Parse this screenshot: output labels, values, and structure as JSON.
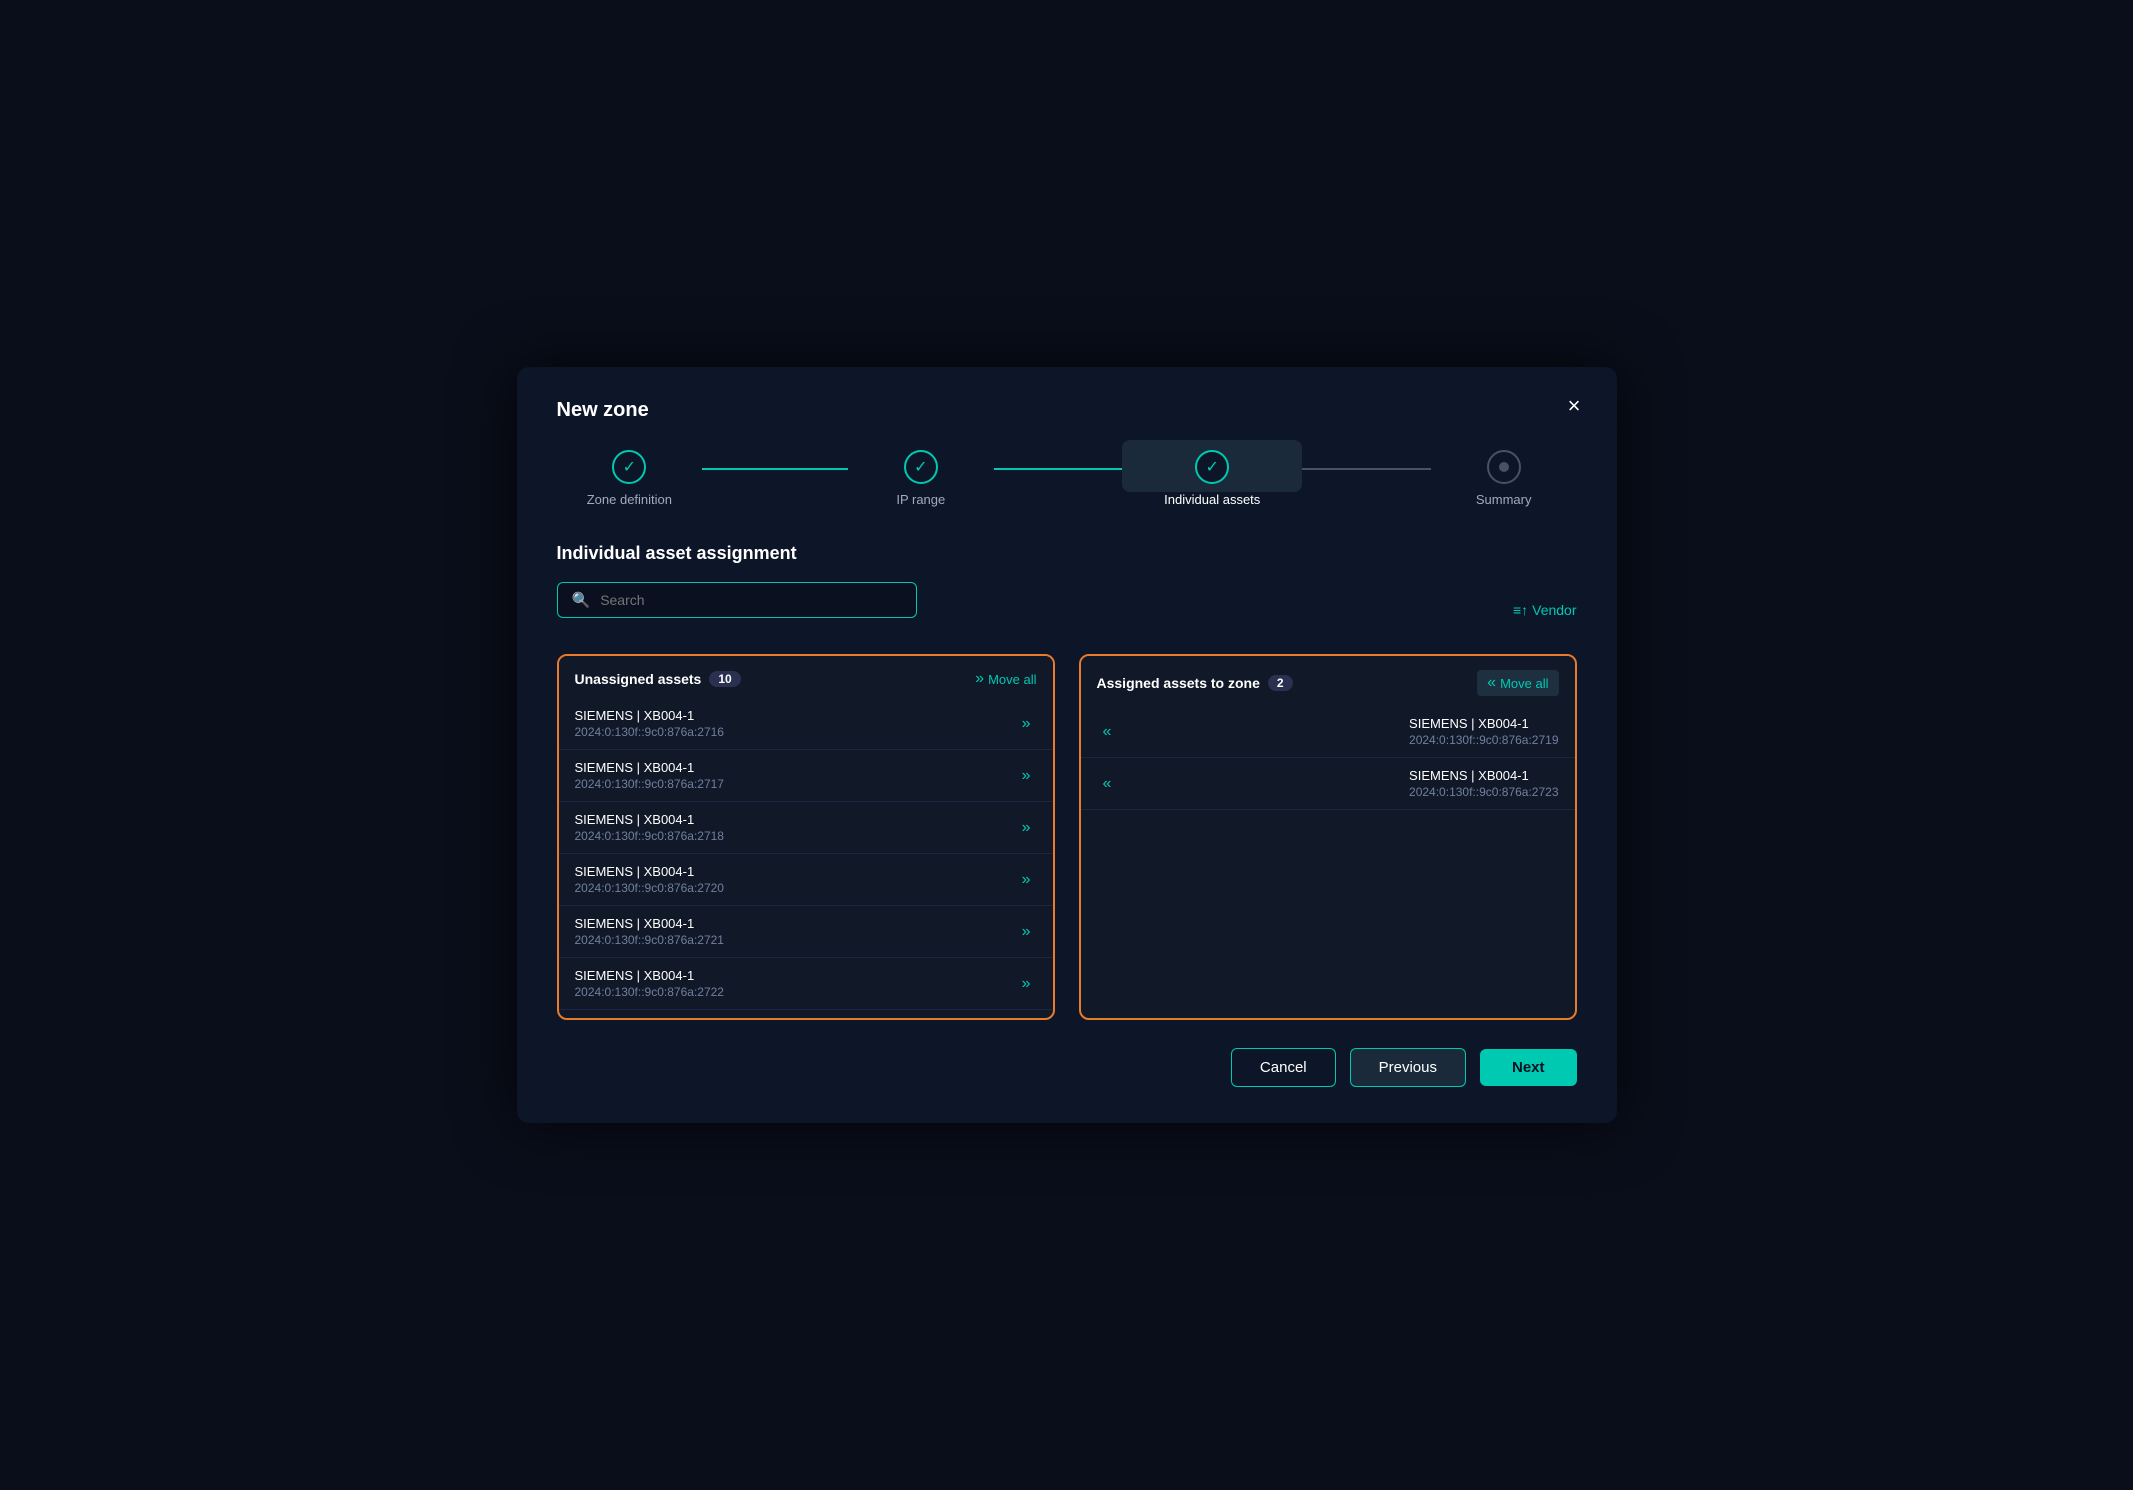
{
  "dialog": {
    "title": "New zone",
    "close_label": "×"
  },
  "stepper": {
    "steps": [
      {
        "label": "Zone definition",
        "state": "completed"
      },
      {
        "label": "IP range",
        "state": "completed"
      },
      {
        "label": "Individual assets",
        "state": "active"
      },
      {
        "label": "Summary",
        "state": "inactive"
      }
    ]
  },
  "section": {
    "title": "Individual asset assignment"
  },
  "search": {
    "placeholder": "Search"
  },
  "vendor_filter": {
    "label": "Vendor"
  },
  "unassigned_panel": {
    "title": "Unassigned assets",
    "count": "10",
    "move_all_label": "Move all"
  },
  "assigned_panel": {
    "title": "Assigned assets to zone",
    "count": "2",
    "move_all_label": "Move all"
  },
  "unassigned_assets": [
    {
      "name": "SIEMENS | XB004-1",
      "ip": "2024:0:130f::9c0:876a:2716"
    },
    {
      "name": "SIEMENS | XB004-1",
      "ip": "2024:0:130f::9c0:876a:2717"
    },
    {
      "name": "SIEMENS | XB004-1",
      "ip": "2024:0:130f::9c0:876a:2718"
    },
    {
      "name": "SIEMENS | XB004-1",
      "ip": "2024:0:130f::9c0:876a:2720"
    },
    {
      "name": "SIEMENS | XB004-1",
      "ip": "2024:0:130f::9c0:876a:2721"
    },
    {
      "name": "SIEMENS | XB004-1",
      "ip": "2024:0:130f::9c0:876a:2722"
    }
  ],
  "assigned_assets": [
    {
      "name": "SIEMENS | XB004-1",
      "ip": "2024:0:130f::9c0:876a:2719"
    },
    {
      "name": "SIEMENS | XB004-1",
      "ip": "2024:0:130f::9c0:876a:2723"
    }
  ],
  "footer": {
    "cancel_label": "Cancel",
    "previous_label": "Previous",
    "next_label": "Next"
  }
}
